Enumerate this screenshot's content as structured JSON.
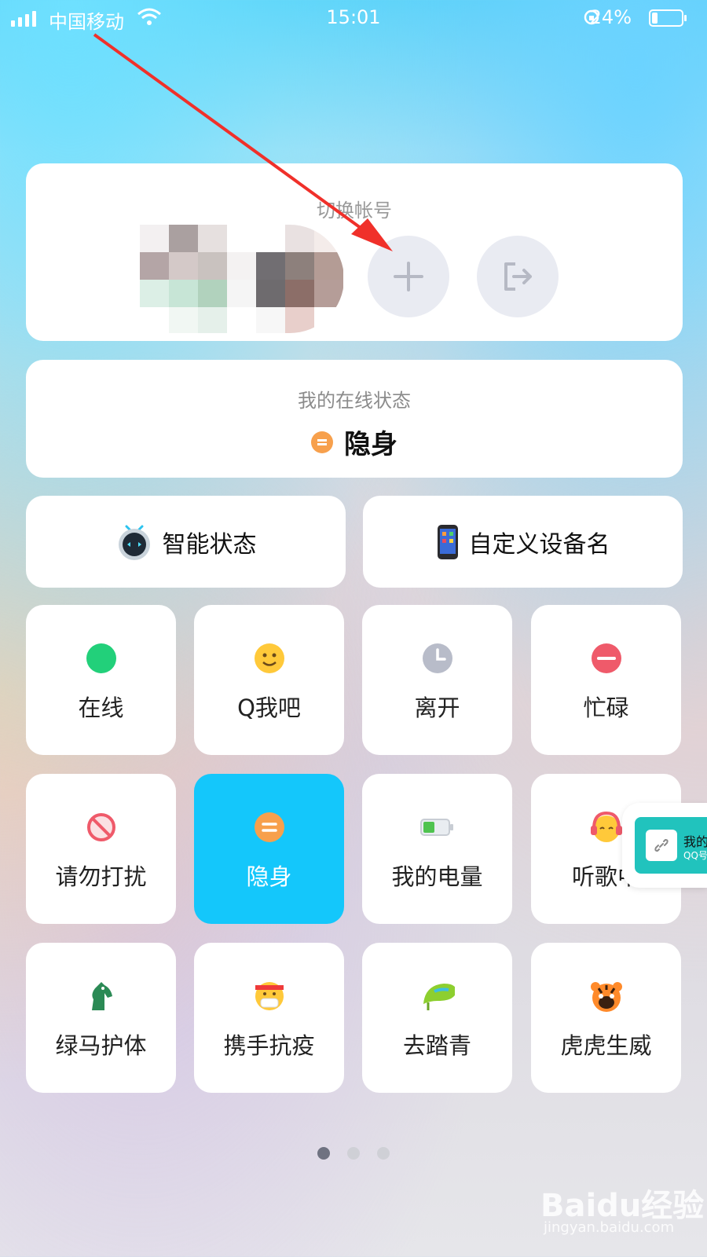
{
  "status_bar": {
    "carrier": "中国移动",
    "time": "15:01",
    "battery_percent": "24%",
    "battery_level": 0.24
  },
  "account_card": {
    "title": "切换帐号",
    "add_icon": "plus-icon",
    "logout_icon": "logout-icon"
  },
  "online_status": {
    "label": "我的在线状态",
    "current": "隐身",
    "current_icon": "invisible-icon"
  },
  "wide_buttons": [
    {
      "label": "智能状态",
      "icon": "robot-icon"
    },
    {
      "label": "自定义设备名",
      "icon": "phone-icon"
    }
  ],
  "status_tiles": [
    {
      "label": "在线",
      "icon": "green-dot-icon"
    },
    {
      "label": "Q我吧",
      "icon": "smile-icon"
    },
    {
      "label": "离开",
      "icon": "clock-icon"
    },
    {
      "label": "忙碌",
      "icon": "busy-icon"
    },
    {
      "label": "请勿打扰",
      "icon": "no-entry-icon"
    },
    {
      "label": "隐身",
      "icon": "invisible-icon",
      "selected": true
    },
    {
      "label": "我的电量",
      "icon": "battery-icon"
    },
    {
      "label": "听歌中",
      "icon": "headphone-icon"
    },
    {
      "label": "绿马护体",
      "icon": "green-horse-icon"
    },
    {
      "label": "携手抗疫",
      "icon": "mask-icon"
    },
    {
      "label": "去踏青",
      "icon": "leaf-icon"
    },
    {
      "label": "虎虎生威",
      "icon": "tiger-icon"
    }
  ],
  "floating_widget": {
    "line1": "我的",
    "line2": "QQ号"
  },
  "pager": {
    "pages": 3,
    "current": 1
  },
  "watermark": {
    "brand": "Baidu经验",
    "url": "jingyan.baidu.com"
  },
  "colors": {
    "selected_tile": "#14c7fb",
    "online_green": "#22d07a",
    "invisible_orange": "#f7a04c",
    "busy_red": "#ef5a6a",
    "annotation_arrow": "#f0302a"
  }
}
